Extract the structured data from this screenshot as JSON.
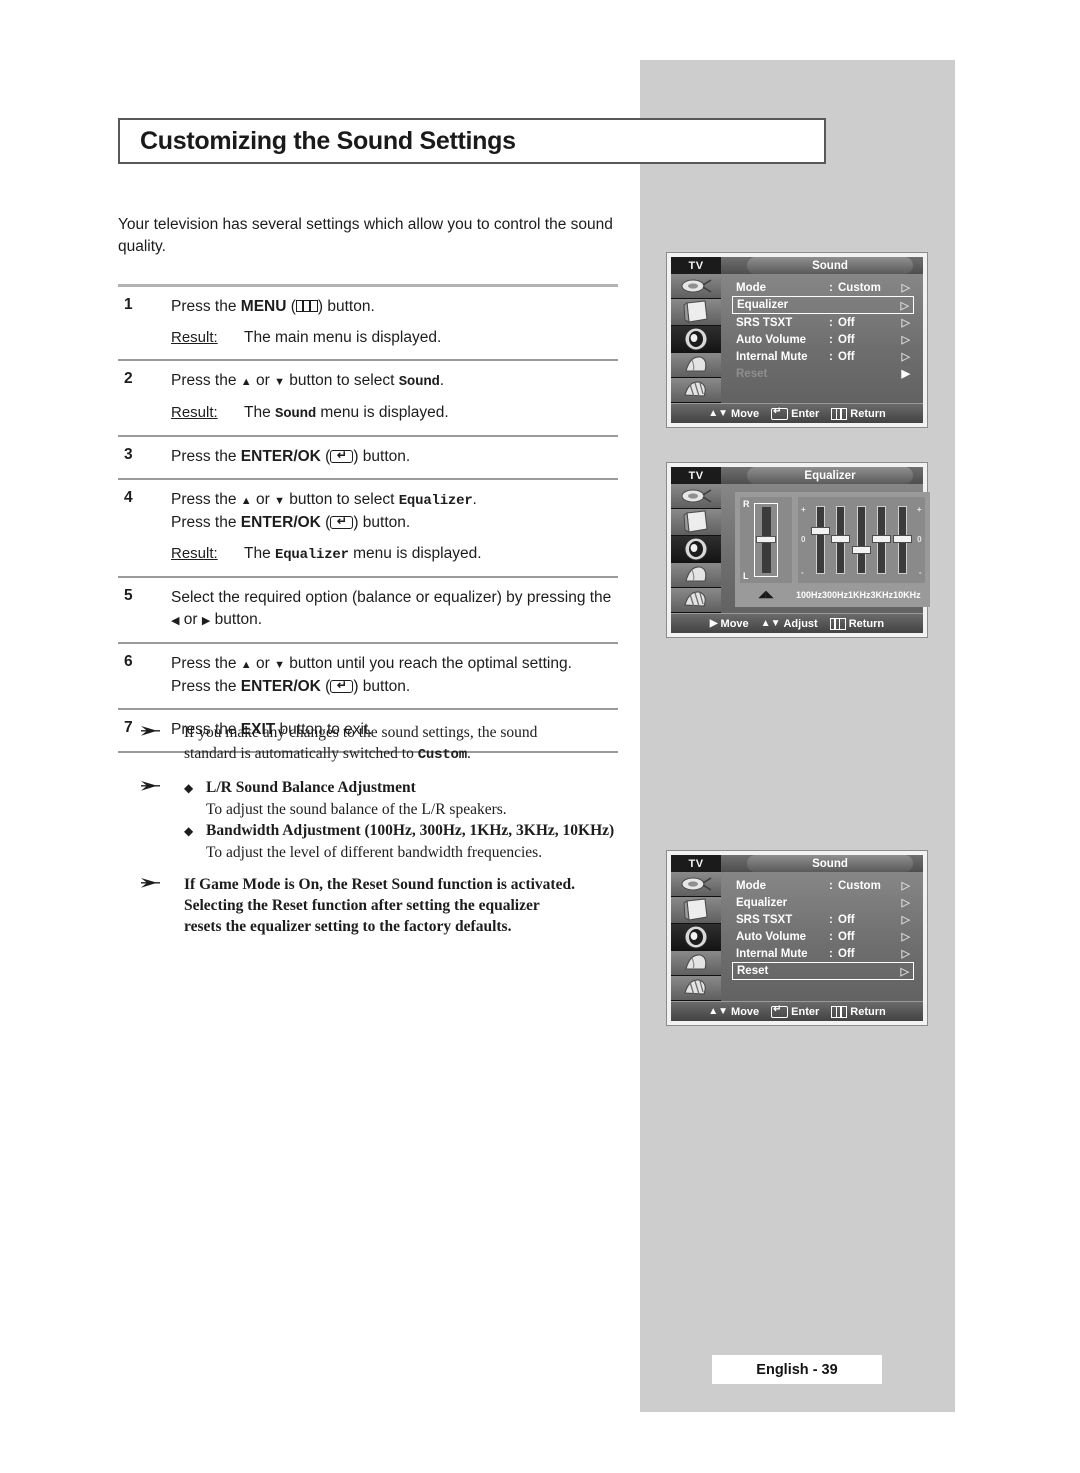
{
  "page": {
    "title": "Customizing the Sound Settings",
    "intro": "Your television has several settings which allow you to control the sound quality.",
    "footer": "English - 39"
  },
  "steps": [
    {
      "num": "1",
      "lines": [
        "Press the |b:MENU| (|icon:menu-icon|) button."
      ],
      "result_label": "Result:",
      "result_text": "The main menu is displayed."
    },
    {
      "num": "2",
      "lines": [
        "Press the |tri-up| or |tri-dn| button to select |m:Sound|."
      ],
      "result_label": "Result:",
      "result_text_pre": "The ",
      "result_mono": "Sound",
      "result_text_post": " menu is displayed."
    },
    {
      "num": "3",
      "lines": [
        "Press the |b:ENTER/OK| (|icon:enter-icon|) button."
      ]
    },
    {
      "num": "4",
      "lines": [
        "Press the |tri-up| or |tri-dn| button to select |m:Equalizer|.",
        "Press the |b:ENTER/OK| (|icon:enter-icon|) button."
      ],
      "result_label": "Result:",
      "result_text_pre": "The ",
      "result_mono": "Equalizer",
      "result_text_post": " menu is displayed."
    },
    {
      "num": "5",
      "lines": [
        "Select the required option (balance or equalizer) by pressing the",
        "|tri-lf| or |tri-rt| button."
      ]
    },
    {
      "num": "6",
      "lines": [
        "Press the |tri-up| or |tri-dn| button until you reach the optimal setting.",
        "Press the |b:ENTER/OK| (|icon:enter-icon|) button."
      ]
    },
    {
      "num": "7",
      "lines": [
        "Press the |b:EXIT| button to exit."
      ]
    }
  ],
  "step_text": {
    "s1_a": "Press the ",
    "s1_menu": "MENU",
    "s1_b": " (",
    "s1_c": ") button.",
    "result_label": "Result:",
    "r1": "The main menu is displayed.",
    "s2_a": "Press the ",
    "s2_b": " or ",
    "s2_c": " button to select ",
    "s2_sound": "Sound",
    "s2_d": ".",
    "r2_a": "The ",
    "r2_sound": "Sound",
    "r2_b": " menu is displayed.",
    "s3_a": "Press the ",
    "s3_enter": "ENTER/OK",
    "s3_b": " (",
    "s3_c": ") button.",
    "s4_equalizer": "Equalizer",
    "r4_a": "The ",
    "r4_eq": "Equalizer",
    "r4_b": " menu is displayed.",
    "s5_a": "Select the required option (balance or equalizer) by pressing the",
    "s5_b": " or ",
    "s5_c": " button.",
    "s6_a": "Press the ",
    "s6_b": " or ",
    "s6_c": " button until you reach the optimal setting.",
    "s7_a": "Press the ",
    "s7_exit": "EXIT",
    "s7_b": " button to exit."
  },
  "notes": {
    "note1_line1": "If you make any changes to the sound settings, the sound",
    "note1_line2_pre": "standard is automatically switched to ",
    "note1_mono": "Custom",
    "note1_line2_post": ".",
    "bullet1_title": "L/R Sound Balance Adjustment",
    "bullet1_sub": "To adjust the sound balance of the L/R speakers.",
    "bullet2_title": "Bandwidth Adjustment (100Hz, 300Hz, 1KHz, 3KHz, 10KHz)",
    "bullet2_sub": "To adjust the level of different bandwidth frequencies.",
    "note3_line1": "If Game Mode is On, the Reset Sound function is activated.",
    "note3_line2": "Selecting the Reset function after setting the equalizer",
    "note3_line3": "resets the equalizer setting to the factory defaults."
  },
  "osd_common": {
    "tv_label": "TV",
    "move": "Move",
    "enter": "Enter",
    "return": "Return",
    "adjust": "Adjust"
  },
  "osd_sound_1": {
    "title": "Sound",
    "rows": [
      {
        "label": "Mode",
        "colon": ":",
        "value": "Custom",
        "arrow": "▷",
        "state": "normal"
      },
      {
        "label": "Equalizer",
        "colon": "",
        "value": "",
        "arrow": "▷",
        "state": "highlighted"
      },
      {
        "label": "SRS TSXT",
        "colon": ":",
        "value": "Off",
        "arrow": "▷",
        "state": "normal"
      },
      {
        "label": "Auto Volume",
        "colon": ":",
        "value": "Off",
        "arrow": "▷",
        "state": "normal"
      },
      {
        "label": "Internal Mute",
        "colon": ":",
        "value": "Off",
        "arrow": "▷",
        "state": "normal"
      },
      {
        "label": "Reset",
        "colon": "",
        "value": "",
        "arrow": "▶",
        "state": "dim"
      }
    ]
  },
  "osd_equalizer": {
    "title": "Equalizer",
    "balance": {
      "top_label": "R",
      "bottom_label": "L",
      "knob_pct": 50
    },
    "scale_plus": "+",
    "scale_zero_left": "0",
    "scale_zero_right": "0",
    "scale_minus": "-",
    "bands": [
      {
        "freq": "100Hz",
        "level_pct": 62
      },
      {
        "freq": "300Hz",
        "level_pct": 50
      },
      {
        "freq": "1KHz",
        "level_pct": 33
      },
      {
        "freq": "3KHz",
        "level_pct": 50
      },
      {
        "freq": "10KHz",
        "level_pct": 50
      }
    ]
  },
  "osd_sound_2": {
    "title": "Sound",
    "rows": [
      {
        "label": "Mode",
        "colon": ":",
        "value": "Custom",
        "arrow": "▷",
        "state": "normal"
      },
      {
        "label": "Equalizer",
        "colon": "",
        "value": "",
        "arrow": "▷",
        "state": "normal"
      },
      {
        "label": "SRS TSXT",
        "colon": ":",
        "value": "Off",
        "arrow": "▷",
        "state": "normal"
      },
      {
        "label": "Auto Volume",
        "colon": ":",
        "value": "Off",
        "arrow": "▷",
        "state": "normal"
      },
      {
        "label": "Internal Mute",
        "colon": ":",
        "value": "Off",
        "arrow": "▷",
        "state": "normal"
      },
      {
        "label": "Reset",
        "colon": "",
        "value": "",
        "arrow": "▷",
        "state": "highlighted"
      }
    ]
  },
  "sidebar_icons": [
    "antenna-icon",
    "picture-icon",
    "sound-icon",
    "feature-icon",
    "setup-icon"
  ],
  "colors": {
    "panel_gray": "#cdcdcd",
    "rule_gray": "#b3b3b3",
    "text": "#1d1d1d",
    "osd_dark": "#2a2a2a"
  }
}
